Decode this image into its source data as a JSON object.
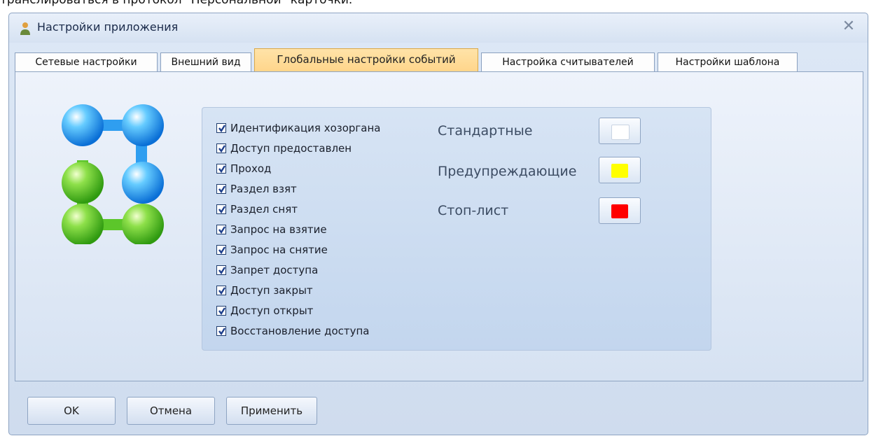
{
  "doc_text": "транслироваться в протокол \"Персональной\" карточки.",
  "window": {
    "title": "Настройки приложения",
    "close_symbol": "✕"
  },
  "tabs": [
    {
      "label": "Сетевые настройки",
      "active": false
    },
    {
      "label": "Внешний вид",
      "active": false
    },
    {
      "label": "Глобальные настройки событий",
      "active": true
    },
    {
      "label": "Настройка считывателей",
      "active": false
    },
    {
      "label": "Настройки шаблона",
      "active": false
    }
  ],
  "events": [
    {
      "label": "Идентификация хозоргана",
      "checked": true
    },
    {
      "label": "Доступ предоставлен",
      "checked": true
    },
    {
      "label": "Проход",
      "checked": true
    },
    {
      "label": "Раздел взят",
      "checked": true
    },
    {
      "label": "Раздел снят",
      "checked": true
    },
    {
      "label": "Запрос на взятие",
      "checked": true
    },
    {
      "label": "Запрос на снятие",
      "checked": true
    },
    {
      "label": "Запрет доступа",
      "checked": true
    },
    {
      "label": "Доступ закрыт",
      "checked": true
    },
    {
      "label": "Доступ открыт",
      "checked": true
    },
    {
      "label": "Восстановление доступа",
      "checked": true
    }
  ],
  "colors": [
    {
      "label": "Стандартные",
      "color": "#ffffff"
    },
    {
      "label": "Предупреждающие",
      "color": "#ffff00"
    },
    {
      "label": "Стоп-лист",
      "color": "#ff0000"
    }
  ],
  "buttons": {
    "ok": "OK",
    "cancel": "Отмена",
    "apply": "Применить"
  }
}
